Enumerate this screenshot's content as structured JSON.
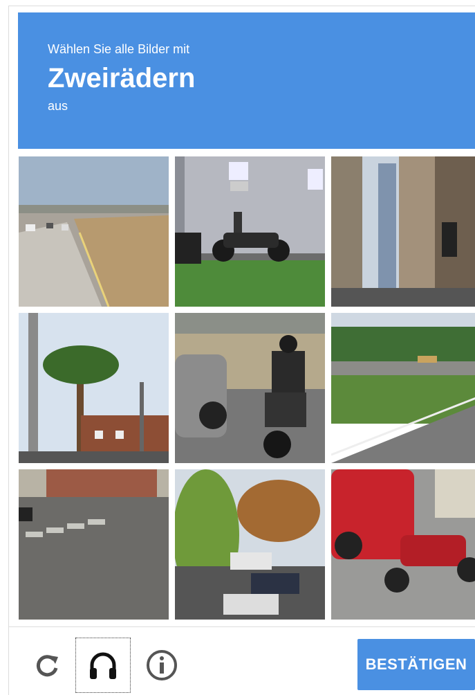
{
  "challenge": {
    "instruction_prefix": "Wählen Sie alle Bilder mit",
    "keyword": "Zweirädern",
    "instruction_suffix": "aus"
  },
  "footer": {
    "reload_icon": "reload-icon",
    "audio_icon": "headphones-icon",
    "info_icon": "info-icon",
    "verify_label": "BESTÄTIGEN"
  },
  "colors": {
    "accent": "#4a90e2",
    "icon": "#555555"
  }
}
